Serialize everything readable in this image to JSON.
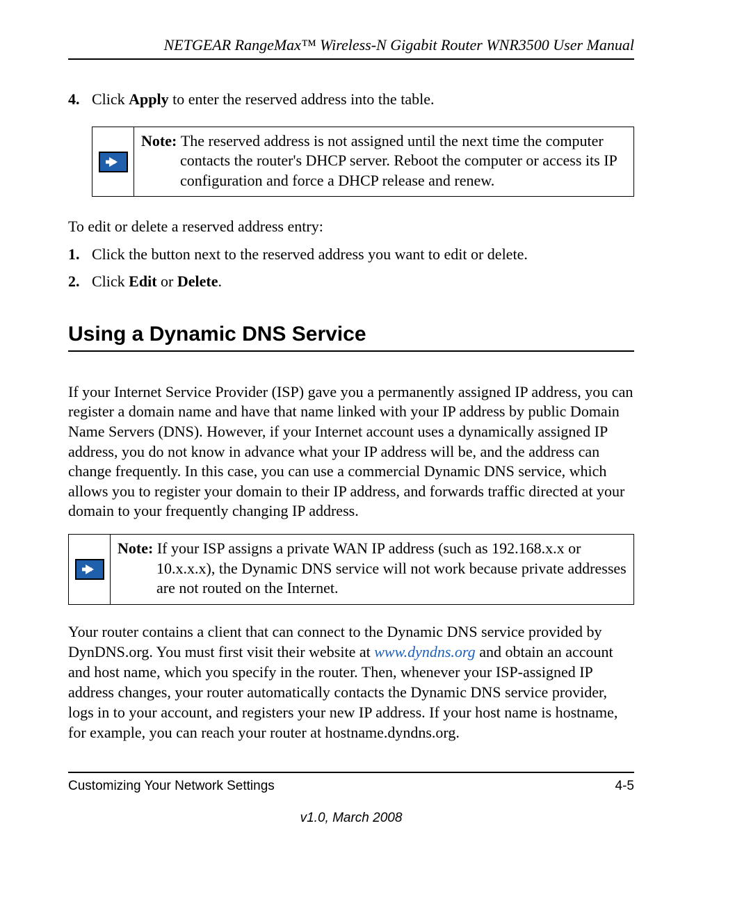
{
  "header": {
    "title": "NETGEAR RangeMax™ Wireless-N Gigabit Router WNR3500 User Manual"
  },
  "step4": {
    "num": "4.",
    "pre": "Click ",
    "bold": "Apply",
    "post": " to enter the reserved address into the table."
  },
  "note1": {
    "label": "Note: ",
    "text": "The reserved address is not assigned until the next time the computer contacts the router's DHCP server. Reboot the computer or access its IP configuration and force a DHCP release and renew."
  },
  "editIntro": "To edit or delete a reserved address entry:",
  "edit1": {
    "num": "1.",
    "text": "Click the button next to the reserved address you want to edit or delete."
  },
  "edit2": {
    "num": "2.",
    "pre": "Click ",
    "b1": "Edit",
    "mid": " or ",
    "b2": "Delete",
    "post": "."
  },
  "h2": "Using a Dynamic DNS Service",
  "dnsPara": "If your Internet Service Provider (ISP) gave you a permanently assigned IP address, you can register a domain name and have that name linked with your IP address by public Domain Name Servers (DNS). However, if your Internet account uses a dynamically assigned IP address, you do not know in advance what your IP address will be, and the address can change frequently. In this case, you can use a commercial Dynamic DNS service, which allows you to register your domain to their IP address, and forwards traffic directed at your domain to your frequently changing IP address.",
  "note2": {
    "label": "Note: ",
    "text": "If your ISP assigns a private WAN IP address (such as 192.168.x.x or 10.x.x.x), the Dynamic DNS service will not work because private addresses are not routed on the Internet."
  },
  "clientPara": {
    "pre": "Your router contains a client that can connect to the Dynamic DNS service provided by DynDNS.org. You must first visit their website at ",
    "link": "www.dyndns.org",
    "post": " and obtain an account and host name, which you specify in the router. Then, whenever your ISP-assigned IP address changes, your router automatically contacts the Dynamic DNS service provider, logs in to your account, and registers your new IP address. If your host name is hostname, for example, you can reach your router at hostname.dyndns.org."
  },
  "footer": {
    "left": "Customizing Your Network Settings",
    "right": "4-5",
    "version": "v1.0, March 2008"
  }
}
